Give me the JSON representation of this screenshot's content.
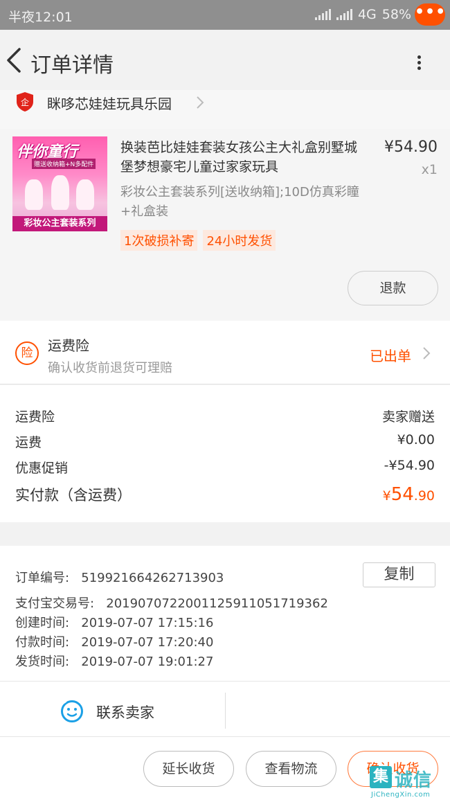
{
  "status_bar": {
    "time": "半夜12:01",
    "network": "4G",
    "battery": "58%"
  },
  "header": {
    "title": "订单详情",
    "message_badge": "•••"
  },
  "shop": {
    "name": "眯哆芯娃娃玩具乐园",
    "icon_text": "企"
  },
  "item": {
    "title": "换装芭比娃娃套装女孩公主大礼盒别墅城堡梦想豪宅儿童过家家玩具",
    "sku": "彩妆公主套装系列[送收纳箱];10D仿真彩瞳+礼盒装",
    "price": "¥54.90",
    "quantity": "x1",
    "tags": [
      "1次破损补寄",
      "24小时发货"
    ],
    "refund_label": "退款",
    "thumbnail": {
      "banner": "伴你童行",
      "sub": "赠送收纳箱+N多配件",
      "bottom": "彩妆公主套装系列"
    }
  },
  "insurance": {
    "icon_text": "险",
    "title": "运费险",
    "desc": "确认收货前退货可理赔",
    "status": "已出单"
  },
  "fees": {
    "rows": [
      {
        "label": "运费险",
        "value": "卖家赠送"
      },
      {
        "label": "运费",
        "value": "¥0.00"
      },
      {
        "label": "优惠促销",
        "value": "-¥54.90"
      }
    ],
    "total": {
      "label": "实付款（含运费）",
      "currency": "¥",
      "integer": "54",
      "decimal": ".90"
    }
  },
  "order_info": {
    "order_no_label": "订单编号:",
    "order_no": "519921664262713903",
    "copy_label": "复制",
    "alipay_label": "支付宝交易号:",
    "alipay_no": "2019070722001125911051719362",
    "created_label": "创建时间:",
    "created": "2019-07-07 17:15:16",
    "paid_label": "付款时间:",
    "paid": "2019-07-07 17:20:40",
    "shipped_label": "发货时间:",
    "shipped": "2019-07-07 19:01:27"
  },
  "contact": {
    "label": "联系卖家"
  },
  "actions": {
    "extend": "延长收货",
    "logistics": "查看物流",
    "confirm": "确认收货"
  },
  "watermark": {
    "logo": "集",
    "text": "诚信",
    "url": "JiChengXin.com"
  },
  "colors": {
    "accent": "#ff5000",
    "status_bar": "#8f8f8f"
  }
}
